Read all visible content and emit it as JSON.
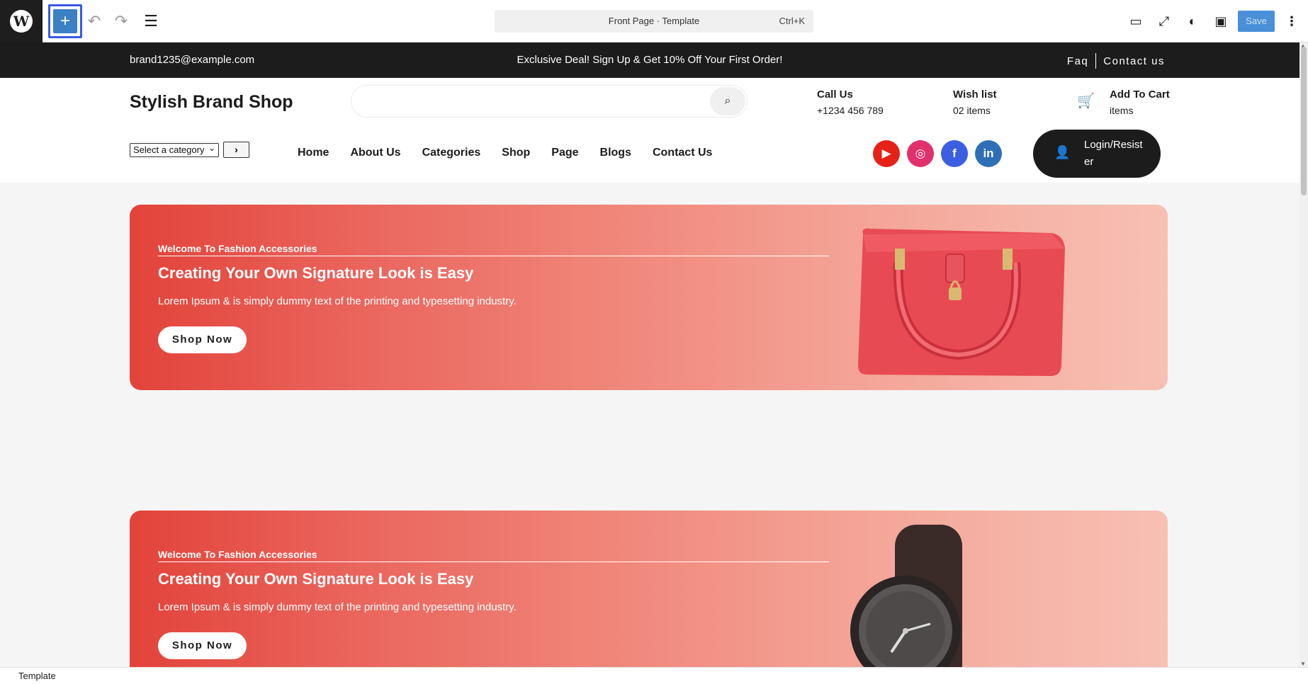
{
  "editor": {
    "doc_title": "Front Page · Template",
    "shortcut": "Ctrl+K",
    "save_label": "Save",
    "add_icon": "+",
    "undo_icon": "↶",
    "redo_icon": "↷",
    "list_icon": "☰",
    "more_icon": "⋮",
    "desktop_icon": "▭",
    "fullscreen_icon": "⤢",
    "styles_icon": "◐",
    "settings_icon": "▣",
    "accent_color": "#3858e9"
  },
  "topstrip": {
    "email": "brand1235@example.com",
    "deal": "Exclusive Deal! Sign Up & Get 10% Off Your First Order!",
    "faq": "Faq",
    "contact": "Contact us"
  },
  "header": {
    "brand": "Stylish Brand Shop",
    "search_icon": "⌕",
    "call_label": "Call Us",
    "call_value": "+1234 456 789",
    "wish_label": "Wish list",
    "wish_value": "02 items",
    "cart_label": "Add To Cart",
    "cart_value": "items",
    "cart_icon": "🛒",
    "category_select": "Select a category",
    "go_icon": "›",
    "nav": [
      "Home",
      "About Us",
      "Categories",
      "Shop",
      "Page",
      "Blogs",
      "Contact Us"
    ],
    "social": {
      "youtube": "▶",
      "instagram": "◎",
      "facebook": "f",
      "linkedin": "in"
    },
    "login_icon": "👤",
    "login_label": "Login/Resister"
  },
  "banners": [
    {
      "eyebrow": "Welcome To Fashion Accessories",
      "title": "Creating Your Own Signature Look is Easy",
      "desc": "Lorem Ipsum & is simply dummy text of the printing and typesetting industry.",
      "button": "Shop Now"
    },
    {
      "eyebrow": "Welcome To Fashion Accessories",
      "title": "Creating Your Own Signature Look is Easy",
      "desc": "Lorem Ipsum & is simply dummy text of the printing and typesetting industry.",
      "button": "Shop Now"
    }
  ],
  "footer": {
    "breadcrumb": "Template"
  }
}
